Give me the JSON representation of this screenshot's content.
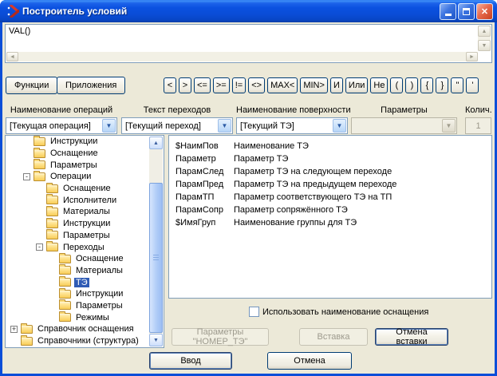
{
  "window": {
    "title": "Построитель условий",
    "controls": {
      "minimize": "minimize",
      "maximize": "maximize",
      "close": "✕"
    }
  },
  "expression": {
    "value": "VAL()"
  },
  "toolbar": {
    "functions_label": "Функции",
    "applications_label": "Приложения",
    "operators": [
      "<",
      ">",
      "<=",
      ">=",
      "!=",
      "<>",
      "MAX<",
      "MIN>",
      "И",
      "Или",
      "Не",
      "(",
      ")",
      "{",
      "}",
      "\"",
      "'"
    ]
  },
  "selectors": {
    "operations": {
      "label": "Наименование операций",
      "value": "[Текущая операция]",
      "enabled": true
    },
    "transitions": {
      "label": "Текст переходов",
      "value": "[Текущий переход]",
      "enabled": true
    },
    "surfaces": {
      "label": "Наименование поверхности",
      "value": "[Текущий ТЭ]",
      "enabled": true
    },
    "parameters": {
      "label": "Параметры",
      "value": "",
      "enabled": false
    },
    "quantity": {
      "label": "Колич.",
      "value": "1",
      "enabled": false
    }
  },
  "tree": {
    "items": [
      {
        "label": "Инструкции",
        "level": 1
      },
      {
        "label": "Оснащение",
        "level": 1
      },
      {
        "label": "Параметры",
        "level": 1
      },
      {
        "label": "Операции",
        "level": 1,
        "expander": "minus"
      },
      {
        "label": "Оснащение",
        "level": 2
      },
      {
        "label": "Исполнители",
        "level": 2
      },
      {
        "label": "Материалы",
        "level": 2
      },
      {
        "label": "Инструкции",
        "level": 2
      },
      {
        "label": "Параметры",
        "level": 2
      },
      {
        "label": "Переходы",
        "level": 2,
        "expander": "minus"
      },
      {
        "label": "Оснащение",
        "level": 3
      },
      {
        "label": "Материалы",
        "level": 3
      },
      {
        "label": "ТЭ",
        "level": 3,
        "selected": true
      },
      {
        "label": "Инструкции",
        "level": 3
      },
      {
        "label": "Параметры",
        "level": 3
      },
      {
        "label": "Режимы",
        "level": 3
      },
      {
        "label": "Справочник оснащения",
        "level": 0,
        "expander": "plus"
      },
      {
        "label": "Справочники (структура)",
        "level": 0
      }
    ]
  },
  "variables": {
    "items": [
      {
        "name": "$НаимПов",
        "description": "Наименование ТЭ"
      },
      {
        "name": "Параметр",
        "description": "Параметр ТЭ"
      },
      {
        "name": "ПарамСлед",
        "description": "Параметр ТЭ на следующем переходе"
      },
      {
        "name": "ПарамПред",
        "description": "Параметр ТЭ на предыдущем переходе"
      },
      {
        "name": "ПарамТП",
        "description": "Параметр соответствующего ТЭ на ТП"
      },
      {
        "name": "ПарамСопр",
        "description": "Параметр сопряжённого ТЭ"
      },
      {
        "name": "$ИмяГруп",
        "description": "Наименование группы для ТЭ"
      }
    ]
  },
  "footer": {
    "checkbox_label": "Использовать наименование оснащения",
    "checkbox_checked": false,
    "params_button": "Параметры \"НОМЕР_ТЭ\"",
    "insert_button": "Вставка",
    "cancel_insert_button": "Отмена вставки"
  },
  "dialog_buttons": {
    "ok": "Ввод",
    "cancel": "Отмена"
  },
  "colors": {
    "titlebar_blue": "#0B51E0",
    "window_border": "#0A4ED8",
    "dialog_background": "#ECE9D8",
    "field_border": "#7F9DB9",
    "button_border": "#003C74",
    "selection_background": "#2F5BB5",
    "close_button_red": "#C9401F",
    "folder_yellow": "#F8CD57"
  }
}
